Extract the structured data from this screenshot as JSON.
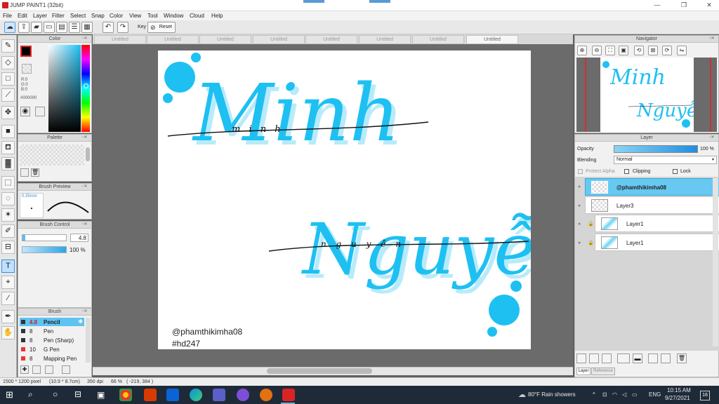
{
  "window": {
    "title": "JUMP PAINT1 (32bit)",
    "min": "—",
    "max": "❐",
    "close": "✕"
  },
  "menu": [
    "File",
    "Edit",
    "Layer",
    "Filter",
    "Select",
    "Snap",
    "Color",
    "View",
    "Tool",
    "Window",
    "Cloud",
    "Help"
  ],
  "toolbar": {
    "key_label": "Key",
    "reset_label": "Reset"
  },
  "doc_tabs": [
    "Untitled",
    "Untitled",
    "Untitled",
    "Untitled",
    "Untitled",
    "Untitled",
    "Untitled",
    "Untitled"
  ],
  "color_panel": {
    "title": "Color",
    "r": "R:0",
    "g": "G:0",
    "b": "B:0",
    "hex": "#000000"
  },
  "palette_panel": {
    "title": "Palette"
  },
  "brush_preview": {
    "title": "Brush Preview",
    "size": "0.35mm"
  },
  "brush_control": {
    "title": "Brush Control",
    "size_value": "4.8",
    "opacity_value": "100 %"
  },
  "brush_panel": {
    "title": "Brush",
    "items": [
      {
        "size": "4.8",
        "name": "Pencil"
      },
      {
        "size": "8",
        "name": "Pen"
      },
      {
        "size": "8",
        "name": "Pen (Sharp)"
      },
      {
        "size": "10",
        "name": "G Pen"
      },
      {
        "size": "8",
        "name": "Mapping Pen"
      }
    ]
  },
  "navigator": {
    "title": "Navigator"
  },
  "layer_panel": {
    "title": "Layer",
    "opacity_label": "Opacity",
    "opacity_value": "100 %",
    "blending_label": "Blending",
    "blending_value": "Normal",
    "protect_alpha": "Protect Alpha",
    "clipping": "Clipping",
    "lock": "Lock",
    "layers": [
      {
        "name": "@phamthikimha08"
      },
      {
        "name": "Layer3"
      },
      {
        "name": "Layer1"
      },
      {
        "name": "Layer1"
      }
    ],
    "tab_layer": "Layer",
    "tab_reference": "Reference"
  },
  "artwork": {
    "word1": "Minh",
    "word2": "Nguyễn",
    "small1": "m i n h",
    "small2": "n g u y ễ n",
    "credit": "@phamthikimha08",
    "tag": "#hd247"
  },
  "status": {
    "size": "1500 * 1200 pixel",
    "dims": "(10.9 * 8.7cm)",
    "dpi": "350 dpi",
    "zoom": "66 %",
    "coord": "( -219, 384 )"
  },
  "taskbar": {
    "weather": "80°F  Rain showers",
    "lang": "ENG",
    "time": "10:15 AM",
    "date": "9/27/2021",
    "notif": "16"
  },
  "colors": {
    "accent_blue": "#1ec0f2",
    "highlight": "#67c9f1"
  }
}
